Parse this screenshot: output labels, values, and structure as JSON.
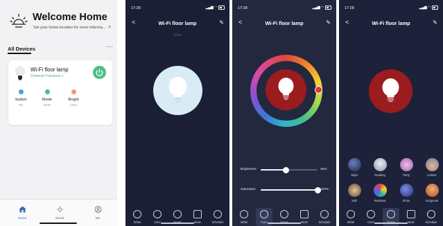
{
  "home": {
    "title": "Welcome Home",
    "subtitle": "Set your home location for more informa...",
    "arrow": ">",
    "all_devices": "All Devices",
    "more": "···",
    "device": {
      "name": "Wi-Fi floor lamp",
      "common_functions": "Common Functions >",
      "features": [
        {
          "name": "Switch",
          "value": "ON",
          "color": "#4aa3e0"
        },
        {
          "name": "Mode",
          "value": "White",
          "color": "#4bbf85"
        },
        {
          "name": "Bright",
          "value": "100%",
          "color": "#f29b6b"
        }
      ]
    },
    "tabs": [
      {
        "label": "Home",
        "icon": "home-icon"
      },
      {
        "label": "Smart",
        "icon": "sun-icon"
      },
      {
        "label": "Me",
        "icon": "person-icon"
      }
    ]
  },
  "device_screen": {
    "time": "17:28",
    "title": "Wi-Fi floor lamp",
    "white_label": "White",
    "modes": [
      {
        "label": "White",
        "icon": "white-mode-icon"
      },
      {
        "label": "Color",
        "icon": "color-palette-icon"
      },
      {
        "label": "Scene",
        "icon": "scene-icon"
      },
      {
        "label": "Music",
        "icon": "music-icon"
      },
      {
        "label": "Schedule",
        "icon": "clock-icon"
      }
    ]
  },
  "color_screen": {
    "brightness_label": "Brightness",
    "brightness_value": "45%",
    "brightness_level": 0.45,
    "saturation_label": "Saturation",
    "saturation_value": "100%",
    "saturation_level": 1.0
  },
  "scene_screen": {
    "scenes_row1": [
      "Night",
      "Reading",
      "Party",
      "Leisure"
    ],
    "scenes_row2": [
      "Soft",
      "Rainbow",
      "Shine",
      "Gorgeous"
    ]
  },
  "colors": {
    "accent_green": "#4bbf85",
    "home_tab_blue": "#3a66b8",
    "dark_bg": "#1a1f36",
    "bulb_red": "#9b1c1f"
  }
}
